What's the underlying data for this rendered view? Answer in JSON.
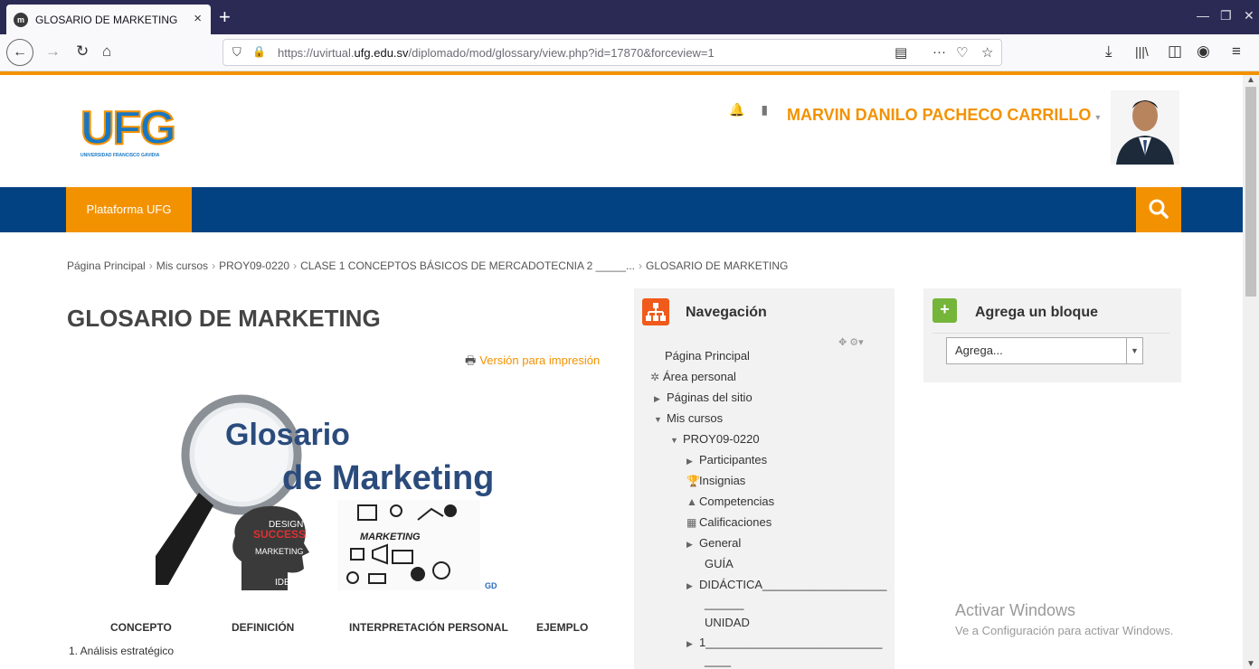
{
  "browser": {
    "tab_title": "GLOSARIO DE MARKETING",
    "tab_close": "×",
    "new_tab": "+",
    "url_prefix": "https://uvirtual.",
    "url_domain": "ufg.edu.sv",
    "url_path": "/diplomado/mod/glossary/view.php?id=17870&forceview=1",
    "url_more": "···"
  },
  "header": {
    "logo_text": "UFG",
    "logo_subtitle": "UNIVERSIDAD FRANCISCO GAVIDIA",
    "user_name": "MARVIN DANILO PACHECO CARRILLO",
    "user_caret": "▾"
  },
  "mainnav": {
    "item": "Plataforma UFG"
  },
  "breadcrumb": [
    "Página Principal",
    "Mis cursos",
    "PROY09-0220",
    "CLASE 1 CONCEPTOS BÁSICOS DE MERCADOTECNIA 2 _____...",
    "GLOSARIO DE MARKETING"
  ],
  "breadcrumb_sep": "›",
  "content": {
    "title": "GLOSARIO DE MARKETING",
    "print_link": "Versión para impresión",
    "image_word1": "Glosario",
    "image_word2": "de Marketing",
    "image_tag1": "SUCCESS",
    "image_tag2": "DESIGN",
    "image_tag3": "MARKETING",
    "image_tag4": "IDEA",
    "image_tag5": "MARKETING",
    "image_tag6": "GD",
    "columns": [
      "CONCEPTO",
      "DEFINICIÓN",
      "INTERPRETACIÓN PERSONAL",
      "EJEMPLO"
    ],
    "first_term": "1. Análisis estratégico"
  },
  "nav_block": {
    "title": "Navegación",
    "controls": "✥ ⚙▾",
    "items": [
      "Página Principal",
      "Área personal",
      "Páginas del sitio",
      "Mis cursos",
      "PROY09-0220",
      "Participantes",
      "Insignias",
      "Competencias",
      "Calificaciones",
      "General",
      "GUÍA",
      "DIDÁCTICA___________________",
      "______",
      "UNIDAD",
      "1___________________________",
      "____"
    ]
  },
  "add_block": {
    "title": "Agrega un bloque",
    "select_value": "Agrega..."
  },
  "watermark": {
    "line1": "Activar Windows",
    "line2": "Ve a Configuración para activar Windows."
  },
  "colors": {
    "brand_orange": "#f39200",
    "nav_blue": "#034282",
    "tab_bg": "#2b2a55"
  }
}
